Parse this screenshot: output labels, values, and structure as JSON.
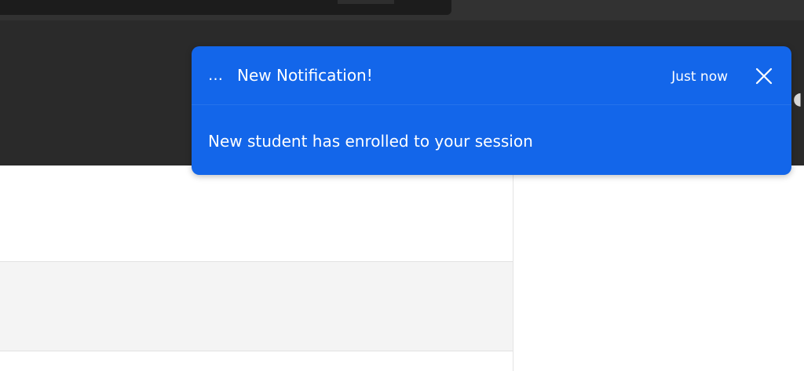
{
  "notification": {
    "prefix": "…",
    "title": "New Notification!",
    "time": "Just now",
    "message": "New student has enrolled to your session",
    "close_icon": "close-icon"
  },
  "colors": {
    "toast_bg": "#1366ea",
    "header_bg": "#2a2a2a",
    "top_strip_bg": "#323232",
    "content_bg": "#ffffff",
    "content_alt_bg": "#f4f4f4"
  }
}
